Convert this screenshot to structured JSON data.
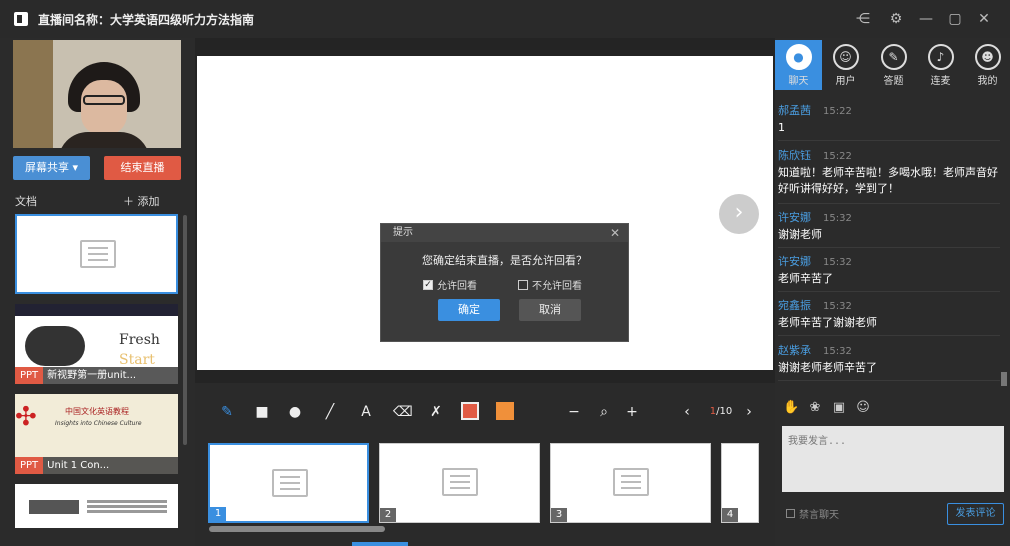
{
  "window": {
    "title": "直播间名称：大学英语四级听力方法指南"
  },
  "left": {
    "share_button": "屏幕共享 ▾",
    "end_live_button": "结束直播",
    "docs_label": "文档",
    "add_label": "＋ 添加",
    "docs": [
      {
        "tag": "",
        "name": ""
      },
      {
        "tag": "PPT",
        "name": "新视野第一册unit...",
        "slide_text_1": "Fresh",
        "slide_text_2": "Start"
      },
      {
        "tag": "PPT",
        "name": "Unit 1 Con...",
        "slide_text_1": "中国文化英语教程",
        "slide_text_2": "Insights into Chinese Culture"
      },
      {
        "tag": "",
        "name": ""
      }
    ]
  },
  "dialog": {
    "title": "提示",
    "message": "您确定结束直播，是否允许回看？",
    "option_allow": "允许回看",
    "option_deny": "不允许回看",
    "ok": "确定",
    "cancel": "取消"
  },
  "toolbar": {
    "page_current": "1",
    "page_total": "/10"
  },
  "pages": [
    "1",
    "2",
    "3",
    "4"
  ],
  "right": {
    "tabs": [
      "聊天",
      "用户",
      "答题",
      "连麦",
      "我的"
    ],
    "messages": [
      {
        "user": "郝孟茜",
        "time": "15:22",
        "text": "1"
      },
      {
        "user": "陈欣钰",
        "time": "15:22",
        "text": "知道啦！老师辛苦啦！多喝水哦！老师声音好好听讲得好好，学到了！"
      },
      {
        "user": "许安娜",
        "time": "15:32",
        "text": "谢谢老师"
      },
      {
        "user": "许安娜",
        "time": "15:32",
        "text": "老师辛苦了"
      },
      {
        "user": "宛鑫振",
        "time": "15:32",
        "text": "老师辛苦了谢谢老师"
      },
      {
        "user": "赵紫承",
        "time": "15:32",
        "text": "谢谢老师老师辛苦了"
      }
    ],
    "input_placeholder": "我要发言...",
    "mute_label": "禁言聊天",
    "send_button": "发表评论"
  }
}
